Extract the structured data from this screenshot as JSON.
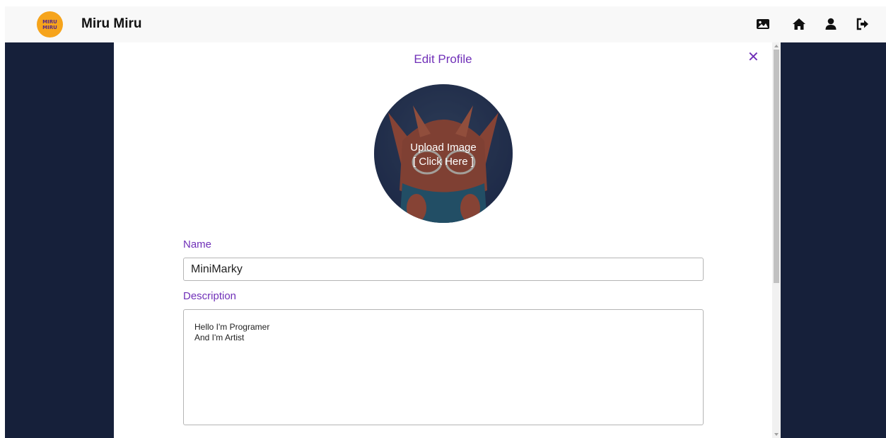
{
  "navbar": {
    "logo_line1": "MIRU",
    "logo_line2": "MIRU",
    "app_title": "Miru Miru",
    "icons": [
      "image-icon",
      "home-icon",
      "user-icon",
      "logout-icon"
    ]
  },
  "modal": {
    "title": "Edit Profile",
    "close_symbol": "✕",
    "upload_line1": "Upload Image",
    "upload_line2": "[ Click Here ]",
    "name_label": "Name",
    "name_value": "MiniMarky",
    "description_label": "Description",
    "description_value": "Hello I'm Programer\nAnd I'm Artist"
  },
  "colors": {
    "accent": "#7030b8",
    "background": "#16203a",
    "navbar": "#f8f8f8",
    "logo": "#f6a41c"
  }
}
